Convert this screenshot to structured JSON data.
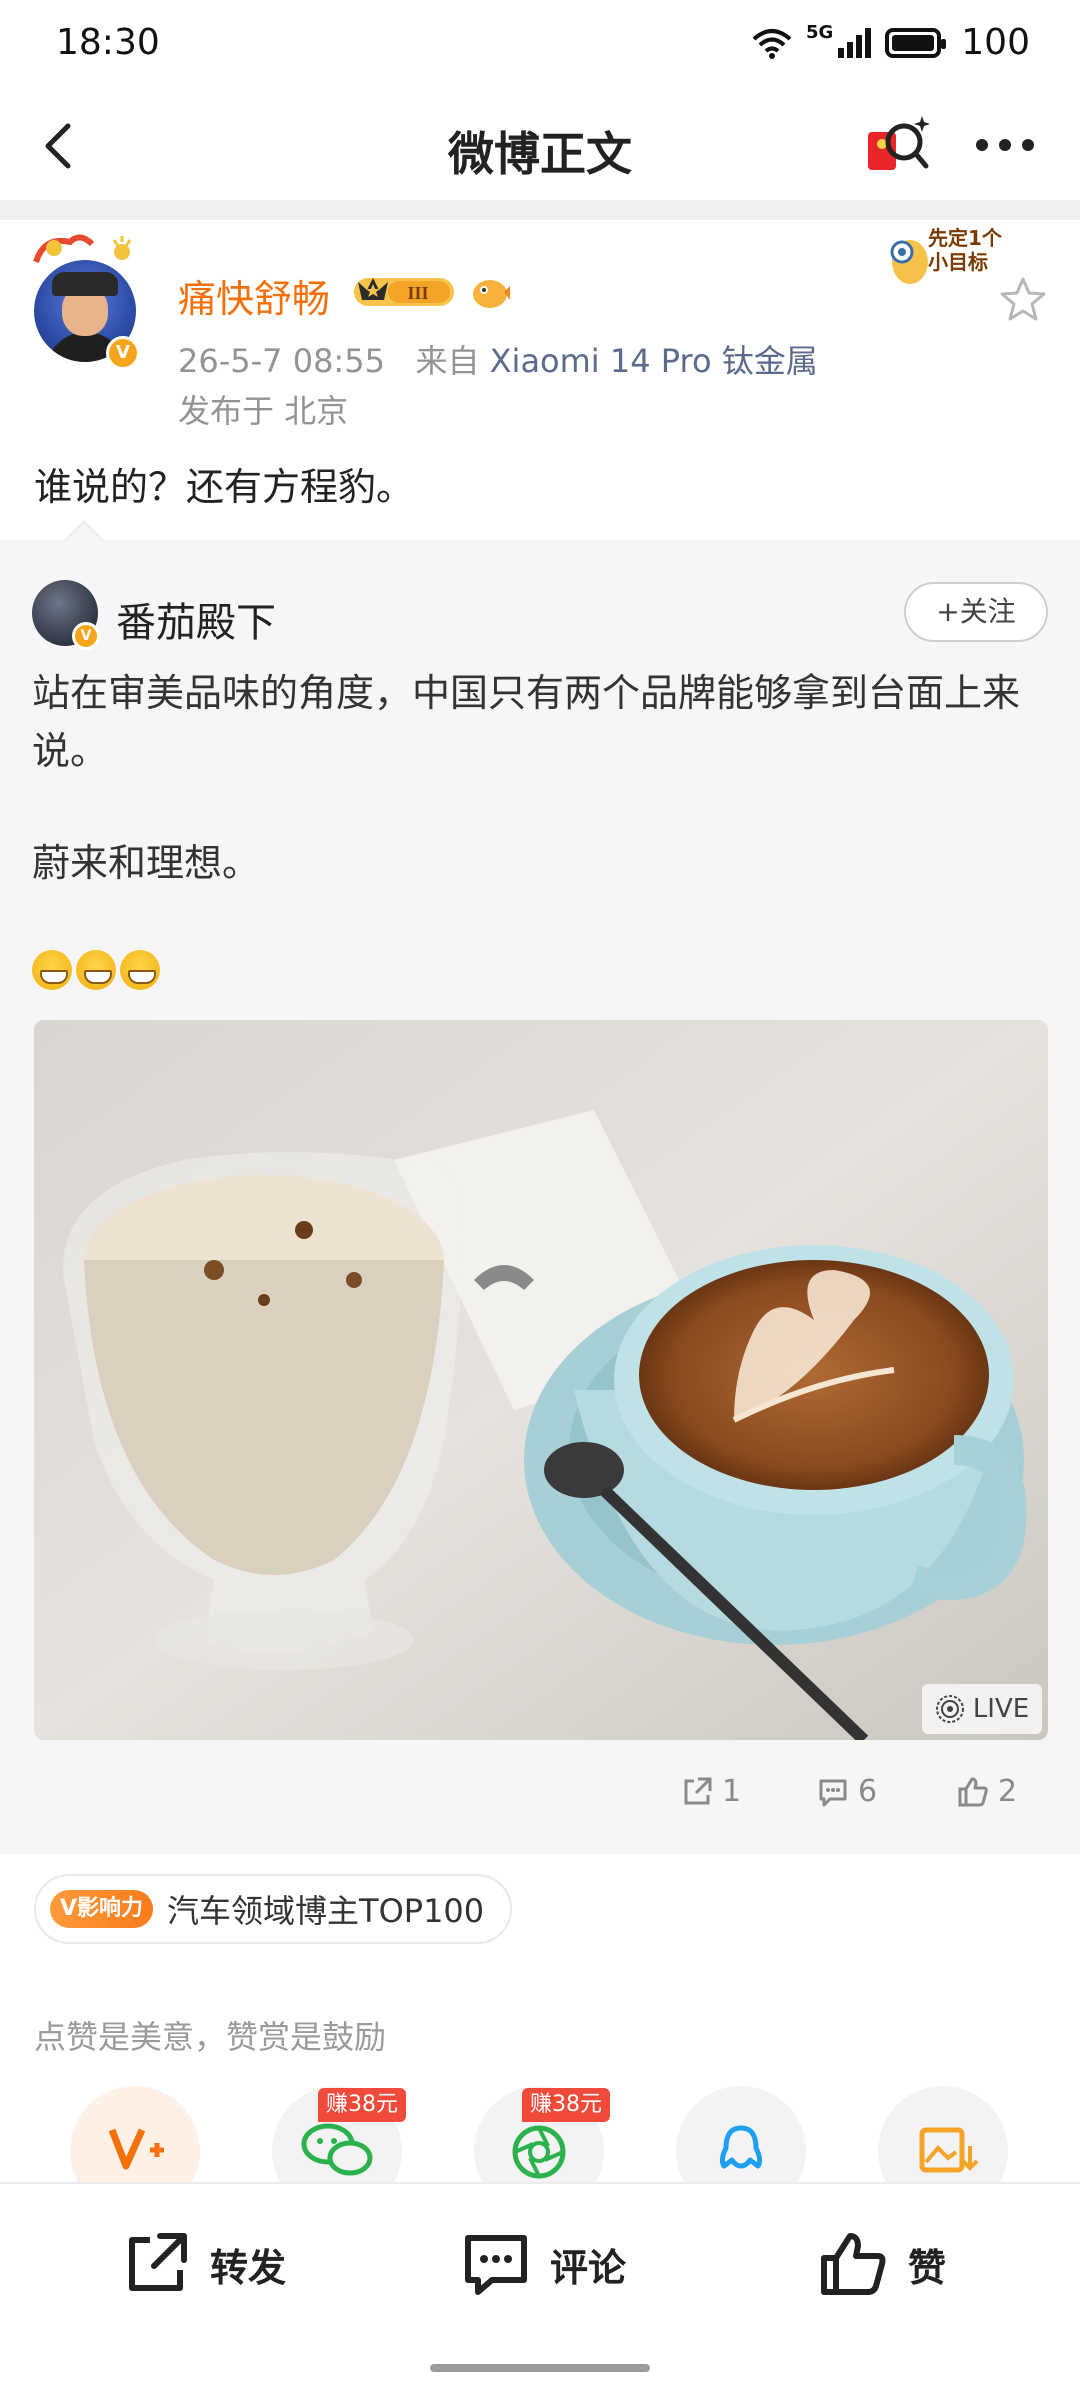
{
  "status_bar": {
    "time": "18:30",
    "network": "5G",
    "battery": "100"
  },
  "nav": {
    "title": "微博正文"
  },
  "post": {
    "author": "痛快舒畅",
    "level": "III",
    "goal_sticker": "先定1个小目标",
    "time": "26-5-7 08:55",
    "source_prefix": "来自",
    "source_device": "Xiaomi 14 Pro 钛金属",
    "location": "发布于 北京",
    "text": "谁说的？还有方程豹。"
  },
  "retweet": {
    "author": "番茄殿下",
    "follow_label": "+关注",
    "paragraphs": [
      "站在审美品味的角度，中国只有两个品牌能够拿到台面上来说。",
      "蔚来和理想。"
    ],
    "emoji_count": 3,
    "live_label": "LIVE",
    "repost_count": "1",
    "comment_count": "6",
    "like_count": "2"
  },
  "influence": {
    "tag": "V影响力",
    "text": "汽车领域博主TOP100"
  },
  "praise_hint": "点赞是美意，赞赏是鼓励",
  "share": {
    "earn_labels": [
      "赚38元",
      "赚38元"
    ],
    "items": [
      "v-plus",
      "wechat",
      "moments",
      "qq",
      "save-image"
    ]
  },
  "bottom_bar": {
    "repost": "转发",
    "comment": "评论",
    "like": "赞"
  },
  "colors": {
    "accent_orange": "#f4700b",
    "earn_red": "#f04a3b",
    "wechat_green": "#2bb24c",
    "qq_blue": "#1ea0f2"
  }
}
